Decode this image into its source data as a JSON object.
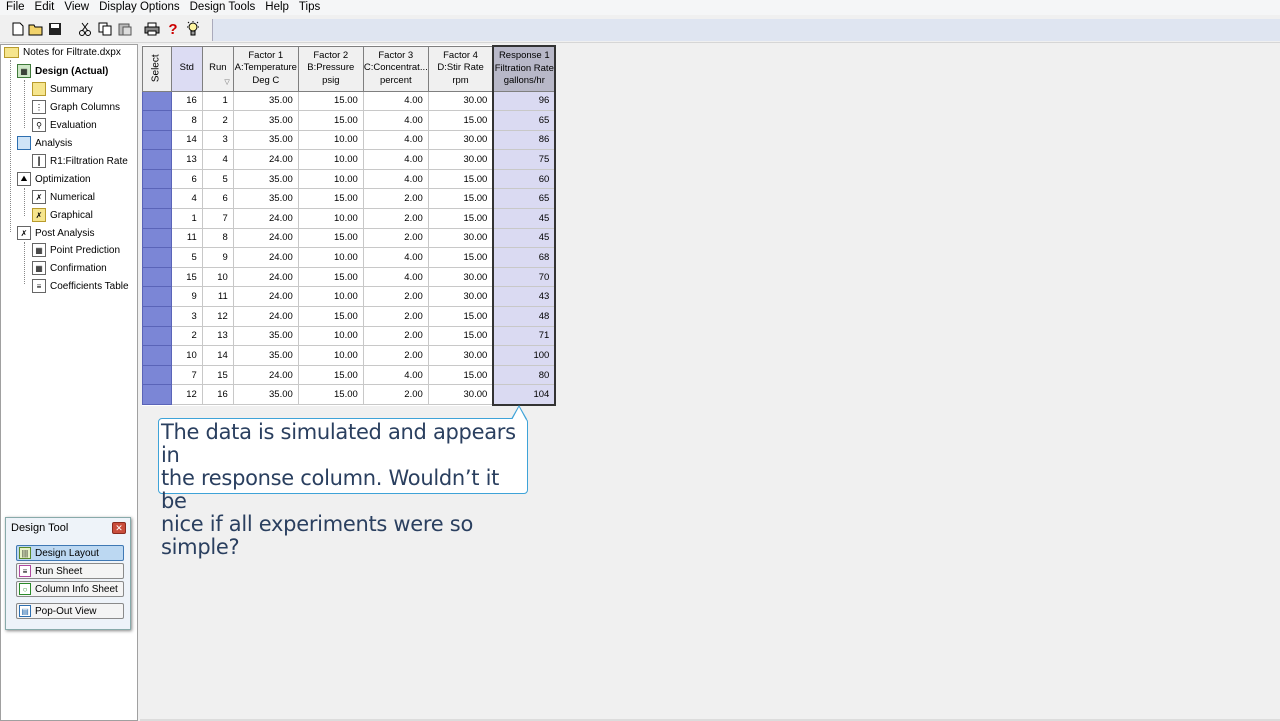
{
  "menu": [
    "File",
    "Edit",
    "View",
    "Display Options",
    "Design Tools",
    "Help",
    "Tips"
  ],
  "toolbar": {
    "icons": [
      "new-file-icon",
      "open-folder-icon",
      "save-icon",
      "cut-icon",
      "copy-icon",
      "paste-icon",
      "print-icon",
      "help-icon",
      "tips-lightbulb-icon"
    ]
  },
  "tree": {
    "root": "Notes for Filtrate.dxpx",
    "design": "Design (Actual)",
    "summary": "Summary",
    "graph_columns": "Graph Columns",
    "evaluation": "Evaluation",
    "analysis": "Analysis",
    "r1": "R1:Filtration Rate",
    "optimization": "Optimization",
    "numerical": "Numerical",
    "graphical": "Graphical",
    "post_analysis": "Post Analysis",
    "point_prediction": "Point Prediction",
    "confirmation": "Confirmation",
    "coefficients_table": "Coefficients Table"
  },
  "grid": {
    "headers": {
      "select": "Select",
      "std": "Std",
      "run": "Run",
      "f1": [
        "Factor 1",
        "A:Temperature",
        "Deg C"
      ],
      "f2": [
        "Factor 2",
        "B:Pressure",
        "psig"
      ],
      "f3": [
        "Factor 3",
        "C:Concentrat...",
        "percent"
      ],
      "f4": [
        "Factor 4",
        "D:Stir Rate",
        "rpm"
      ],
      "r1": [
        "Response 1",
        "Filtration Rate",
        "gallons/hr"
      ]
    },
    "rows": [
      [
        "16",
        "1",
        "35.00",
        "15.00",
        "4.00",
        "30.00",
        "96"
      ],
      [
        "8",
        "2",
        "35.00",
        "15.00",
        "4.00",
        "15.00",
        "65"
      ],
      [
        "14",
        "3",
        "35.00",
        "10.00",
        "4.00",
        "30.00",
        "86"
      ],
      [
        "13",
        "4",
        "24.00",
        "10.00",
        "4.00",
        "30.00",
        "75"
      ],
      [
        "6",
        "5",
        "35.00",
        "10.00",
        "4.00",
        "15.00",
        "60"
      ],
      [
        "4",
        "6",
        "35.00",
        "15.00",
        "2.00",
        "15.00",
        "65"
      ],
      [
        "1",
        "7",
        "24.00",
        "10.00",
        "2.00",
        "15.00",
        "45"
      ],
      [
        "11",
        "8",
        "24.00",
        "15.00",
        "2.00",
        "30.00",
        "45"
      ],
      [
        "5",
        "9",
        "24.00",
        "10.00",
        "4.00",
        "15.00",
        "68"
      ],
      [
        "15",
        "10",
        "24.00",
        "15.00",
        "4.00",
        "30.00",
        "70"
      ],
      [
        "9",
        "11",
        "24.00",
        "10.00",
        "2.00",
        "30.00",
        "43"
      ],
      [
        "3",
        "12",
        "24.00",
        "15.00",
        "2.00",
        "15.00",
        "48"
      ],
      [
        "2",
        "13",
        "35.00",
        "10.00",
        "2.00",
        "15.00",
        "71"
      ],
      [
        "10",
        "14",
        "35.00",
        "10.00",
        "2.00",
        "30.00",
        "100"
      ],
      [
        "7",
        "15",
        "24.00",
        "15.00",
        "4.00",
        "15.00",
        "80"
      ],
      [
        "12",
        "16",
        "35.00",
        "15.00",
        "2.00",
        "30.00",
        "104"
      ]
    ]
  },
  "callout": {
    "text": "The data is simulated and appears in\nthe response  column.  Wouldn’t it be\nnice if all experiments were so simple?"
  },
  "design_tool": {
    "title": "Design Tool",
    "buttons": [
      "Design Layout",
      "Run Sheet",
      "Column Info Sheet",
      "Pop-Out View"
    ]
  }
}
